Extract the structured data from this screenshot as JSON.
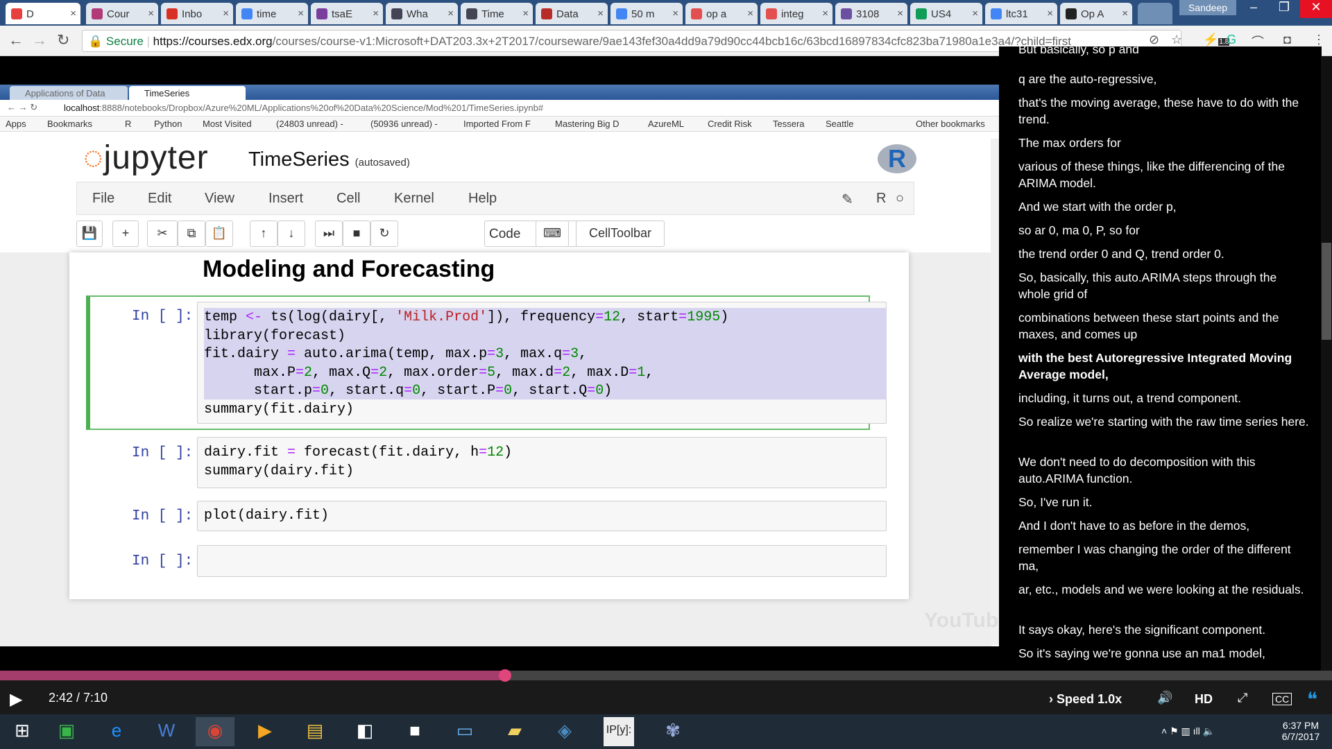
{
  "browser": {
    "tabs": [
      {
        "label": "D",
        "active": true
      },
      {
        "label": "Cour"
      },
      {
        "label": "Inbo"
      },
      {
        "label": "time"
      },
      {
        "label": "tsaE"
      },
      {
        "label": "Wha"
      },
      {
        "label": "Time"
      },
      {
        "label": "Data"
      },
      {
        "label": "50 m"
      },
      {
        "label": "op a"
      },
      {
        "label": "integ"
      },
      {
        "label": "3108"
      },
      {
        "label": "US4"
      },
      {
        "label": "ltc31"
      },
      {
        "label": "Op A"
      }
    ],
    "user": "Sandeep",
    "secure_label": "Secure",
    "url_host": "https://courses.edx.org",
    "url_path": "/courses/course-v1:Microsoft+DAT203.3x+2T2017/courseware/9ae143fef30a4dd9a79d90cc44bcb16c/63bcd16897834cfc823ba71980a1e3a4/?child=first",
    "ext_badge": "1.8"
  },
  "inner_browser": {
    "tabs": [
      {
        "label": "Applications of Data"
      },
      {
        "label": "TimeSeries",
        "active": true
      }
    ],
    "url_host": "localhost",
    "url_path": ":8888/notebooks/Dropbox/Azure%20ML/Applications%20of%20Data%20Science/Mod%201/TimeSeries.ipynb#",
    "bookmarks": [
      "Apps",
      "Bookmarks",
      "R",
      "Python",
      "Most Visited",
      "(24803 unread) -",
      "(50936 unread) -",
      "Imported From F",
      "Mastering Big D",
      "AzureML",
      "Credit Risk",
      "Tessera",
      "Seattle",
      "Other bookmarks"
    ]
  },
  "jupyter": {
    "logo": "jupyter",
    "notebook_name": "TimeSeries",
    "saved_status": "(autosaved)",
    "kernel_logo": "R",
    "kernel_name": "R",
    "menu": [
      "File",
      "Edit",
      "View",
      "Insert",
      "Cell",
      "Kernel",
      "Help"
    ],
    "cell_type": "Code",
    "celltoolbar_label": "CellToolbar",
    "heading": "Modeling and Forecasting",
    "prompt": "In [ ]:"
  },
  "transcript": {
    "lines": [
      {
        "text": "But basically, so p and"
      },
      {
        "text": "q are the auto-regressive,"
      },
      {
        "text": "that's the moving average, these have to do with the trend."
      },
      {
        "text": "The max orders for"
      },
      {
        "text": "various of these things, like the differencing of the ARIMA model."
      },
      {
        "text": "And we start with the order p,"
      },
      {
        "text": "so ar 0, ma 0, P, so for"
      },
      {
        "text": "the trend order 0 and Q, trend order 0."
      },
      {
        "text": "So, basically, this auto.ARIMA steps through the whole grid of"
      },
      {
        "text": "combinations between these start points and the maxes, and comes up"
      },
      {
        "text": "with the best Autoregressive Integrated Moving Average model,",
        "current": true
      },
      {
        "text": "including, it turns out, a trend component."
      },
      {
        "text": "So realize we're starting with the raw time series here."
      },
      {
        "text": "We don't need to do decomposition with this auto.ARIMA function."
      },
      {
        "text": "So, I've run it."
      },
      {
        "text": "And I don't have to as before in the demos,"
      },
      {
        "text": "remember I was changing the order of the different ma,"
      },
      {
        "text": "ar, etc., models and we were looking at the residuals."
      },
      {
        "text": "It says okay, here's the significant component."
      },
      {
        "text": "So it's saying we're gonna use an ma1 model,"
      }
    ]
  },
  "player": {
    "time": "2:42 / 7:10",
    "progress": 0.379,
    "speed_label": "Speed",
    "speed_value": "1.0x",
    "hd_label": "HD",
    "cc_label": "CC",
    "watermark": "YouTube"
  },
  "taskbar": {
    "time": "6:37 PM",
    "date": "6/7/2017",
    "apps": [
      "start-icon",
      "store-icon",
      "ie-icon",
      "word-icon",
      "chrome-icon",
      "media-icon",
      "explorer-icon",
      "app-icon",
      "terminal-icon",
      "remote-icon",
      "folder-icon",
      "python-icon",
      "ipython-icon",
      "paint-icon"
    ],
    "ipython_label": "IP[y]:"
  },
  "colors": {
    "titlebar": "#2b4f7e",
    "progress": "#a53d6c",
    "selected_cell": "#4caf50",
    "jupyter_orange": "#f37626"
  }
}
